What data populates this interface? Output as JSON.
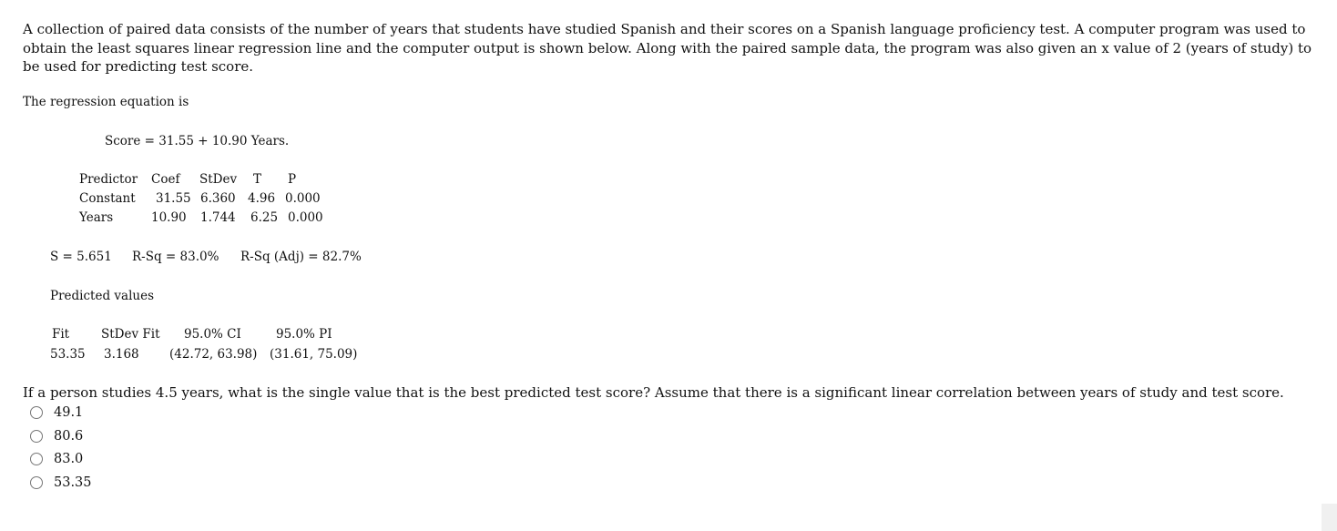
{
  "intro": "A collection of paired data consists of the number of years that students have studied Spanish and their scores on a Spanish language proficiency test. A computer program was used to obtain the least squares linear regression line and the computer output is shown below. Along with the paired sample data, the program was also given an x value of 2 (years of study) to be used for predicting test score.",
  "eq_label": "The regression equation is",
  "equation": "Score = 31.55 + 10.90 Years.",
  "coef_table": {
    "headers": [
      "Predictor",
      "Coef",
      "StDev",
      "T",
      "P"
    ],
    "rows": [
      [
        "Constant",
        "31.55",
        "6.360",
        "4.96",
        "0.000"
      ],
      [
        "Years",
        "10.90",
        "1.744",
        "6.25",
        "0.000"
      ]
    ]
  },
  "stats": {
    "s": "S = 5.651",
    "rsq": "R-Sq = 83.0%",
    "rsq_adj": "R-Sq (Adj) = 82.7%"
  },
  "pred_label": "Predicted values",
  "pred_table": {
    "headers": [
      "Fit",
      "StDev Fit",
      "95.0% CI",
      "95.0% PI"
    ],
    "row": [
      "53.35",
      "3.168",
      "(42.72, 63.98)",
      "(31.61, 75.09)"
    ]
  },
  "question": "If a person studies 4.5 years, what is the single value that is the best predicted test score? Assume that there is a significant linear correlation between years of study and test score.",
  "options": [
    "49.1",
    "80.6",
    "83.0",
    "53.35"
  ]
}
